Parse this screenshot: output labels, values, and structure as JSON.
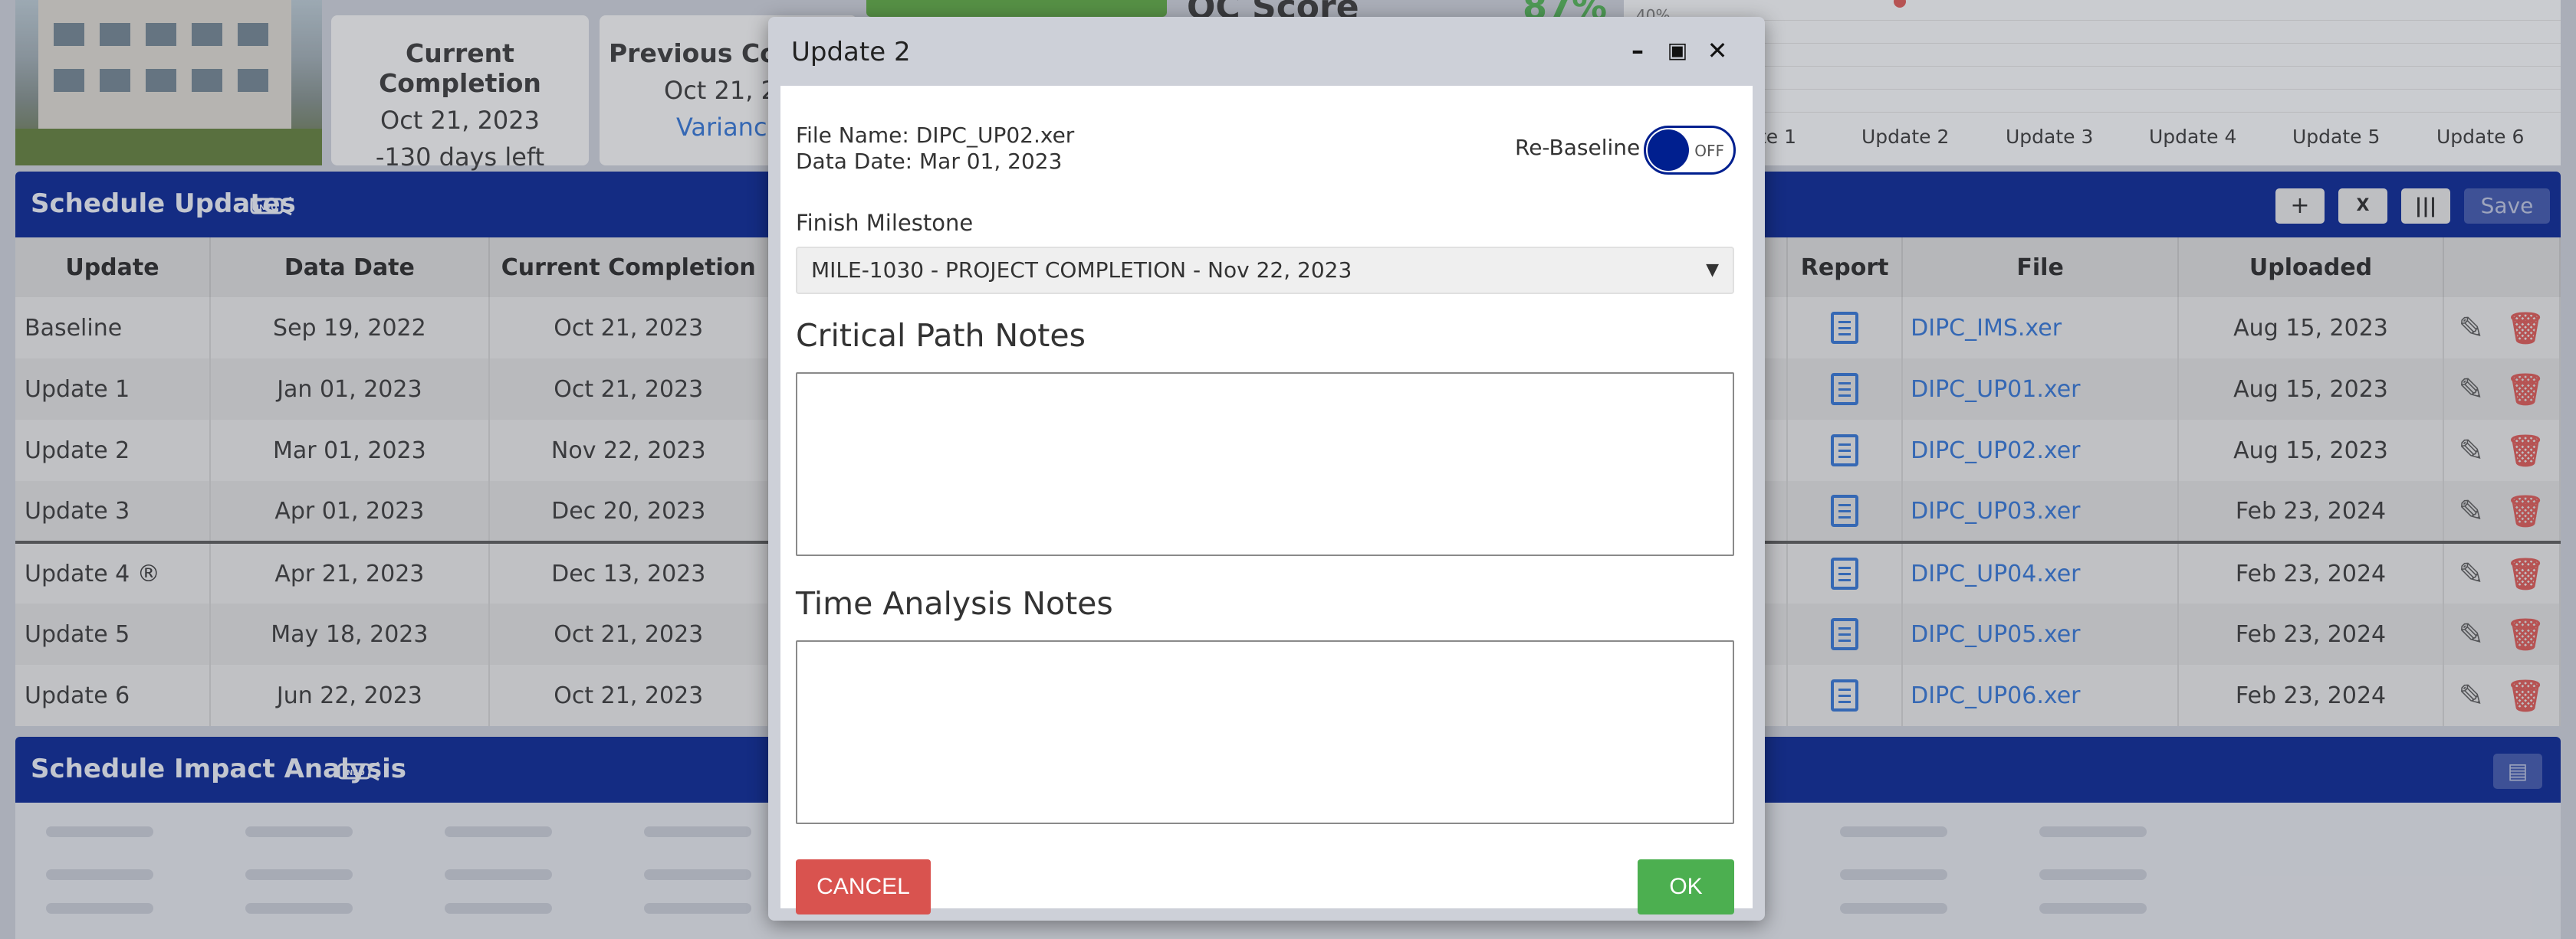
{
  "top": {
    "current_completion": {
      "label": "Current Completion",
      "date": "Oct 21, 2023",
      "days_left": "-130 days left"
    },
    "previous_completion": {
      "label": "Previous Com",
      "date": "Oct 21, 20",
      "variance": "Variance:"
    },
    "qc": {
      "label": "QC Score",
      "value": "87%"
    },
    "chart": {
      "y_tick": "40%",
      "x_labels": [
        "te 1",
        "Update 2",
        "Update 3",
        "Update 4",
        "Update 5",
        "Update 6"
      ]
    }
  },
  "schedule_updates": {
    "title": "Schedule Updates",
    "info_badge": "INFO",
    "buttons": {
      "add": "+",
      "excel": "X",
      "columns": "|||",
      "save": "Save"
    },
    "columns": [
      "Update",
      "Data Date",
      "Current Completion",
      "Report",
      "File",
      "Uploaded"
    ],
    "rows": [
      {
        "update": "Baseline",
        "data_date": "Sep 19, 2022",
        "completion": "Oct 21, 2023",
        "file": "DIPC_IMS.xer",
        "uploaded": "Aug 15, 2023"
      },
      {
        "update": "Update 1",
        "data_date": "Jan 01, 2023",
        "completion": "Oct 21, 2023",
        "file": "DIPC_UP01.xer",
        "uploaded": "Aug 15, 2023"
      },
      {
        "update": "Update 2",
        "data_date": "Mar 01, 2023",
        "completion": "Nov 22, 2023",
        "file": "DIPC_UP02.xer",
        "uploaded": "Aug 15, 2023"
      },
      {
        "update": "Update 3",
        "data_date": "Apr 01, 2023",
        "completion": "Dec 20, 2023",
        "file": "DIPC_UP03.xer",
        "uploaded": "Feb 23, 2024"
      },
      {
        "update": "Update 4 ®",
        "data_date": "Apr 21, 2023",
        "completion": "Dec 13, 2023",
        "file": "DIPC_UP04.xer",
        "uploaded": "Feb 23, 2024"
      },
      {
        "update": "Update 5",
        "data_date": "May 18, 2023",
        "completion": "Oct 21, 2023",
        "file": "DIPC_UP05.xer",
        "uploaded": "Feb 23, 2024"
      },
      {
        "update": "Update 6",
        "data_date": "Jun 22, 2023",
        "completion": "Oct 21, 2023",
        "file": "DIPC_UP06.xer",
        "uploaded": "Feb 23, 2024"
      }
    ]
  },
  "impact": {
    "title": "Schedule Impact Analysis",
    "info_badge": "INFO"
  },
  "modal": {
    "title": "Update 2",
    "file_name": "File Name: DIPC_UP02.xer",
    "data_date": "Data Date: Mar 01, 2023",
    "rebaseline_label": "Re-Baseline",
    "rebaseline_state": "OFF",
    "finish_milestone_label": "Finish Milestone",
    "finish_milestone_value": "MILE-1030 - PROJECT COMPLETION - Nov 22, 2023",
    "critical_path_title": "Critical Path Notes",
    "critical_path_value": "",
    "time_analysis_title": "Time Analysis Notes",
    "time_analysis_value": "",
    "cancel_label": "CANCEL",
    "ok_label": "OK"
  }
}
